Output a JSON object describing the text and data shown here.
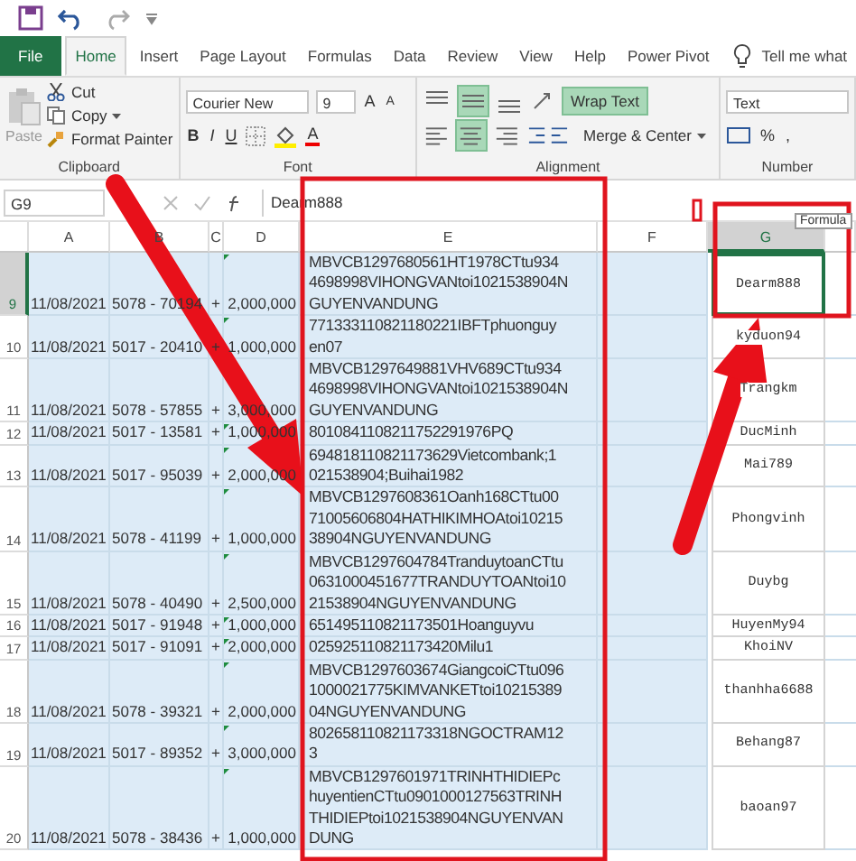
{
  "tabs": [
    {
      "label": "File",
      "kind": "file",
      "selected": false
    },
    {
      "label": "Home",
      "kind": "tab",
      "selected": true
    },
    {
      "label": "Insert",
      "kind": "tab",
      "selected": false
    },
    {
      "label": "Page Layout",
      "kind": "tab",
      "selected": false
    },
    {
      "label": "Formulas",
      "kind": "tab",
      "selected": false
    },
    {
      "label": "Data",
      "kind": "tab",
      "selected": false
    },
    {
      "label": "Review",
      "kind": "tab",
      "selected": false
    },
    {
      "label": "View",
      "kind": "tab",
      "selected": false
    },
    {
      "label": "Help",
      "kind": "tab",
      "selected": false
    },
    {
      "label": "Power Pivot",
      "kind": "tab",
      "selected": false
    }
  ],
  "tell_me": "Tell me what",
  "ribbon": {
    "clipboard": {
      "paste": "Paste",
      "cut": "Cut",
      "copy": "Copy",
      "format_painter": "Format Painter",
      "label": "Clipboard"
    },
    "font": {
      "name": "Courier New",
      "size": "9",
      "grow": "A",
      "shrink": "A",
      "bold": "B",
      "italic": "I",
      "underline": "U",
      "font_color": "A",
      "label": "Font"
    },
    "alignment": {
      "vertical": [
        {
          "kind": "top",
          "on": false
        },
        {
          "kind": "middle",
          "on": true
        },
        {
          "kind": "bottom",
          "on": false
        }
      ],
      "horizontal": [
        {
          "kind": "left",
          "on": false
        },
        {
          "kind": "center",
          "on": true
        },
        {
          "kind": "right",
          "on": false
        }
      ],
      "wrap_text": {
        "label": "Wrap Text",
        "on": true
      },
      "merge": "Merge & Center",
      "label": "Alignment"
    },
    "number": {
      "format": "Text",
      "percent": "%",
      "comma": ",",
      "label": "Number"
    }
  },
  "formula_bar": {
    "name_box": "G9",
    "value": "Dearm888"
  },
  "columns": [
    {
      "label": "A",
      "selected": false
    },
    {
      "label": "B",
      "selected": false
    },
    {
      "label": "C",
      "selected": false
    },
    {
      "label": "D",
      "selected": false
    },
    {
      "label": "E",
      "selected": false
    },
    {
      "label": "F",
      "selected": false
    },
    {
      "label": "G",
      "selected": true
    }
  ],
  "tooltip": "Formula",
  "rows": [
    {
      "num": "9",
      "a": "11/08/2021",
      "b": "5078 - 70194",
      "c": "+",
      "d": "2,000,000",
      "e": [
        "MBVCB1297680561HT1978CTtu934",
        "4698998VIHONGVANtoi1021538904N",
        "GUYENVANDUNG"
      ],
      "g": "Dearm888",
      "selected": true
    },
    {
      "num": "10",
      "a": "11/08/2021",
      "b": "5017 - 20410",
      "c": "+",
      "d": "1,000,000",
      "e": [
        "771333110821180221IBFTphuonguy",
        "en07"
      ],
      "g": "kyduon94",
      "selected": false
    },
    {
      "num": "11",
      "a": "11/08/2021",
      "b": "5078 - 57855",
      "c": "+",
      "d": "3,000,000",
      "e": [
        "MBVCB1297649881VHV689CTtu934",
        "4698998VIHONGVANtoi1021538904N",
        "GUYENVANDUNG"
      ],
      "g": "Trangkm",
      "selected": false
    },
    {
      "num": "12",
      "a": "11/08/2021",
      "b": "5017 - 13581",
      "c": "+",
      "d": "1,000,000",
      "e": [
        "8010841108211752291976PQ"
      ],
      "g": "DucMinh",
      "selected": false
    },
    {
      "num": "13",
      "a": "11/08/2021",
      "b": "5017 - 95039",
      "c": "+",
      "d": "2,000,000",
      "e": [
        "694818110821173629Vietcombank;1",
        "021538904;Buihai1982"
      ],
      "g": "Mai789",
      "selected": false
    },
    {
      "num": "14",
      "a": "11/08/2021",
      "b": "5078 - 41199",
      "c": "+",
      "d": "1,000,000",
      "e": [
        "MBVCB1297608361Oanh168CTtu00",
        "71005606804HATHIKIMHOAtoi10215",
        "38904NGUYENVANDUNG"
      ],
      "g": "Phongvinh",
      "selected": false
    },
    {
      "num": "15",
      "a": "11/08/2021",
      "b": "5078 - 40490",
      "c": "+",
      "d": "2,500,000",
      "e": [
        "MBVCB1297604784TranduytoanCTtu",
        "0631000451677TRANDUYTOANtoi10",
        "21538904NGUYENVANDUNG"
      ],
      "g": "Duybg",
      "selected": false
    },
    {
      "num": "16",
      "a": "11/08/2021",
      "b": "5017 - 91948",
      "c": "+",
      "d": "1,000,000",
      "e": [
        "651495110821173501Hoanguyvu"
      ],
      "g": "HuyenMy94",
      "selected": false
    },
    {
      "num": "17",
      "a": "11/08/2021",
      "b": "5017 - 91091",
      "c": "+",
      "d": "2,000,000",
      "e": [
        "025925110821173420Milu1"
      ],
      "g": "KhoiNV",
      "selected": false
    },
    {
      "num": "18",
      "a": "11/08/2021",
      "b": "5078 - 39321",
      "c": "+",
      "d": "2,000,000",
      "e": [
        "MBVCB1297603674GiangcoiCTtu096",
        "1000021775KIMVANKETtoi10215389",
        "04NGUYENVANDUNG"
      ],
      "g": "thanhha6688",
      "selected": false
    },
    {
      "num": "19",
      "a": "11/08/2021",
      "b": "5017 - 89352",
      "c": "+",
      "d": "3,000,000",
      "e": [
        "802658110821173318NGOCTRAM12",
        "3"
      ],
      "g": "Behang87",
      "selected": false
    },
    {
      "num": "20",
      "a": "11/08/2021",
      "b": "5078 - 38436",
      "c": "+",
      "d": "1,000,000",
      "e": [
        "MBVCB1297601971TRINHTHIDIEPc",
        "huyentienCTtu0901000127563TRINH",
        "THIDIEPtoi1021538904NGUYENVAN",
        "DUNG"
      ],
      "g": "baoan97",
      "selected": false
    }
  ]
}
